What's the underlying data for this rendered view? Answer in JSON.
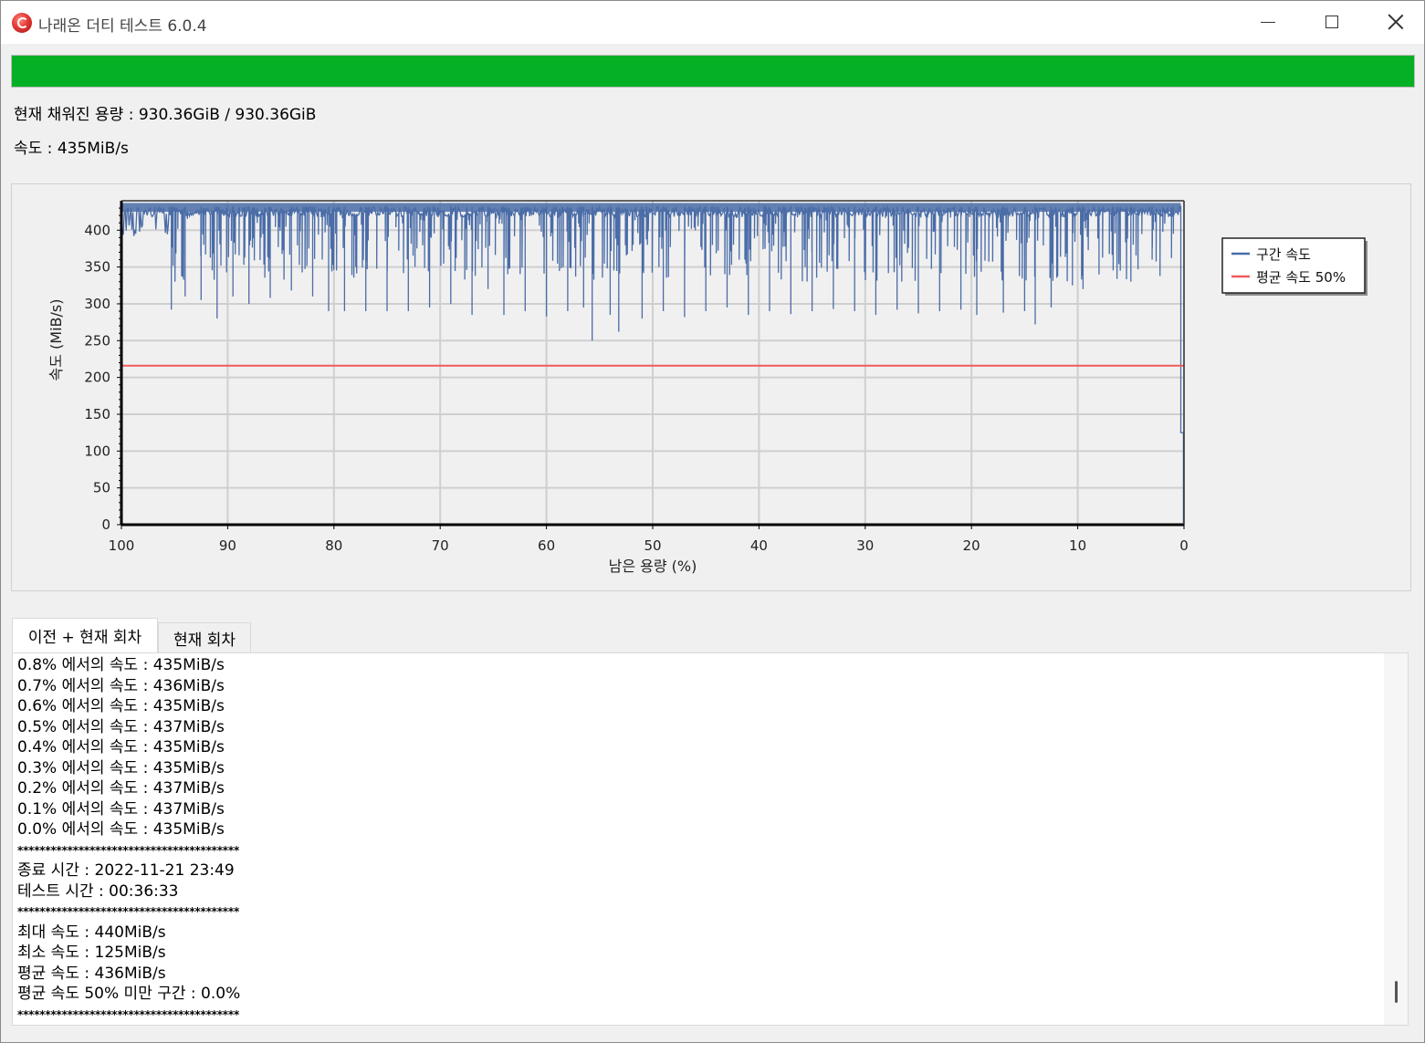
{
  "window": {
    "title": "나래온 더티 테스트 6.0.4",
    "icon": "app-logo-icon",
    "controls": [
      "minimize-icon",
      "maximize-icon",
      "close-icon"
    ]
  },
  "progress": {
    "fraction": 1.0,
    "color": "#06b025"
  },
  "status": {
    "filled": "현재 채워진 용량 : 930.36GiB / 930.36GiB",
    "speed": "속도 : 435MiB/s"
  },
  "chart_data": {
    "type": "line",
    "xlabel": "남은 용량 (%)",
    "ylabel": "속도 (MiB/s)",
    "x_ticks": [
      "100",
      "90",
      "80",
      "70",
      "60",
      "50",
      "40",
      "30",
      "20",
      "10",
      "0"
    ],
    "y_ticks": [
      "0",
      "50",
      "100",
      "150",
      "200",
      "250",
      "300",
      "350",
      "400"
    ],
    "xlim": [
      100,
      0
    ],
    "ylim": [
      0,
      440
    ],
    "grid": true,
    "legend_position": "right",
    "series": [
      {
        "name": "구간 속도",
        "color": "#4a6ca7",
        "baseline": 432,
        "dips": [
          [
            95.3,
            292
          ],
          [
            94.0,
            310
          ],
          [
            92.5,
            305
          ],
          [
            91.0,
            280
          ],
          [
            89.5,
            310
          ],
          [
            88.0,
            300
          ],
          [
            86.0,
            308
          ],
          [
            84.0,
            318
          ],
          [
            82.0,
            310
          ],
          [
            80.5,
            290
          ],
          [
            79.0,
            290
          ],
          [
            77.0,
            290
          ],
          [
            75.0,
            290
          ],
          [
            73.0,
            290
          ],
          [
            71.0,
            295
          ],
          [
            69.0,
            300
          ],
          [
            67.0,
            285
          ],
          [
            65.5,
            320
          ],
          [
            64.0,
            285
          ],
          [
            62.0,
            290
          ],
          [
            60.0,
            283
          ],
          [
            58.0,
            290
          ],
          [
            56.5,
            295
          ],
          [
            55.7,
            250
          ],
          [
            54.0,
            285
          ],
          [
            53.2,
            262
          ],
          [
            51.0,
            280
          ],
          [
            49.0,
            290
          ],
          [
            47.0,
            282
          ],
          [
            45.0,
            290
          ],
          [
            43.0,
            295
          ],
          [
            41.0,
            285
          ],
          [
            39.0,
            290
          ],
          [
            37.0,
            286
          ],
          [
            35.0,
            290
          ],
          [
            33.0,
            293
          ],
          [
            31.0,
            290
          ],
          [
            29.0,
            285
          ],
          [
            27.0,
            292
          ],
          [
            25.0,
            287
          ],
          [
            23.0,
            290
          ],
          [
            21.0,
            292
          ],
          [
            19.5,
            285
          ],
          [
            17.0,
            288
          ],
          [
            15.0,
            290
          ],
          [
            14.0,
            272
          ],
          [
            12.5,
            295
          ],
          [
            10.5,
            325
          ],
          [
            9.5,
            320
          ],
          [
            8.0,
            340
          ],
          [
            6.0,
            345
          ],
          [
            5.0,
            330
          ],
          [
            3.0,
            360
          ],
          [
            1.0,
            395
          ],
          [
            0.3,
            125
          ]
        ]
      },
      {
        "name": "평균 속도 50%",
        "color": "#f05a5a",
        "value": 216
      }
    ]
  },
  "tabs": {
    "active": "이전 + 현재 회차",
    "inactive": "현재 회차"
  },
  "log": {
    "lines": [
      "0.8% 에서의 속도 : 435MiB/s",
      "0.7% 에서의 속도 : 436MiB/s",
      "0.6% 에서의 속도 : 435MiB/s",
      "0.5% 에서의 속도 : 437MiB/s",
      "0.4% 에서의 속도 : 435MiB/s",
      "0.3% 에서의 속도 : 435MiB/s",
      "0.2% 에서의 속도 : 437MiB/s",
      "0.1% 에서의 속도 : 437MiB/s",
      "0.0% 에서의 속도 : 435MiB/s",
      "****************************************",
      "종료 시간 : 2022-11-21 23:49",
      "테스트 시간 : 00:36:33",
      "****************************************",
      "최대 속도 : 440MiB/s",
      "최소 속도 : 125MiB/s",
      "평균 속도 : 436MiB/s",
      "평균 속도 50% 미만 구간 : 0.0%",
      "****************************************"
    ],
    "scroll_position": 0.95
  }
}
